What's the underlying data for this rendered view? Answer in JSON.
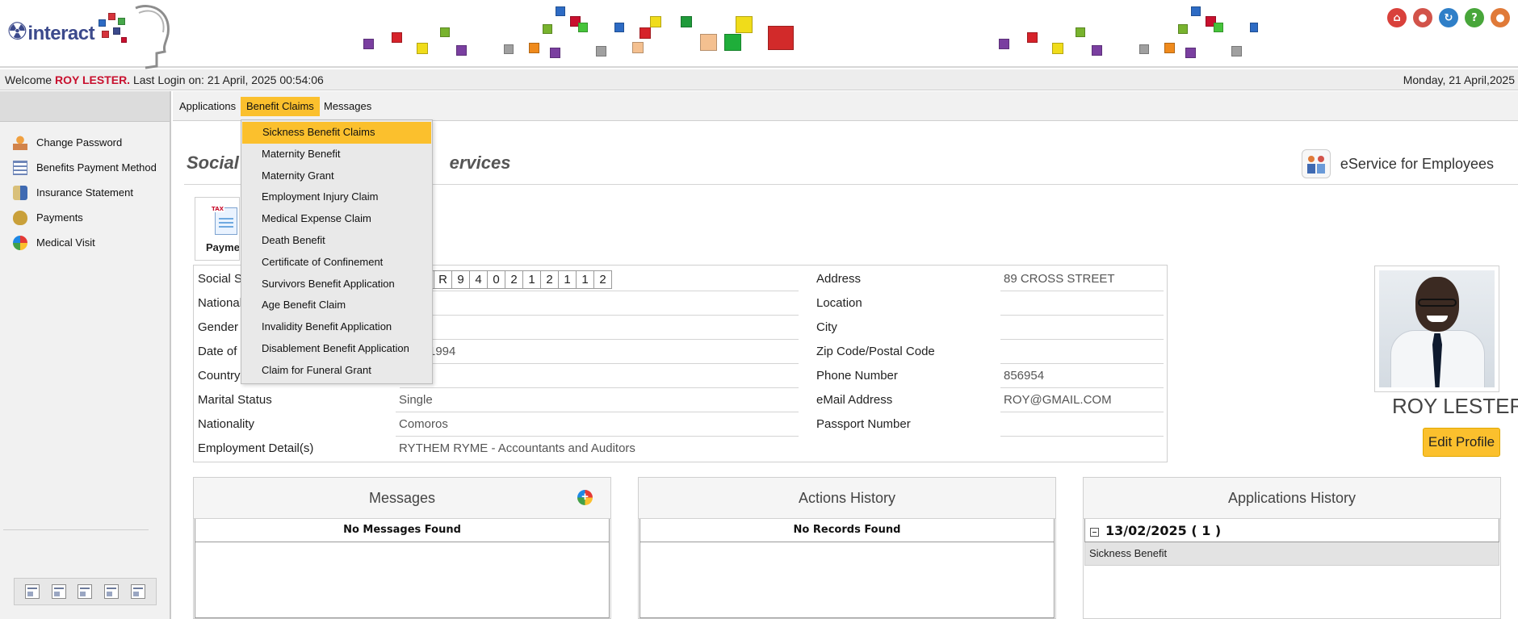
{
  "brand": {
    "logo_text": "interact"
  },
  "header_icons": [
    {
      "icon": "home-icon",
      "color": "#d9413b",
      "glyph": "⌂"
    },
    {
      "icon": "user-icon",
      "color": "#d2534a",
      "glyph": "●"
    },
    {
      "icon": "refresh-icon",
      "color": "#2f7fc8",
      "glyph": "↻"
    },
    {
      "icon": "help-icon",
      "color": "#48a63a",
      "glyph": "?"
    },
    {
      "icon": "logout-icon",
      "color": "#e07a38",
      "glyph": "●"
    }
  ],
  "welcome": {
    "prefix": "Welcome ",
    "user": "ROY LESTER.",
    "last_login": " Last Login on: 21 April, 2025 00:54:06",
    "date": "Monday, 21 April,2025"
  },
  "sidebar": {
    "items": [
      {
        "label": "Change Password",
        "icon": "key-user-icon"
      },
      {
        "label": "Benefits Payment Method",
        "icon": "form-icon"
      },
      {
        "label": "Insurance Statement",
        "icon": "shield-doc-icon"
      },
      {
        "label": "Payments",
        "icon": "money-bag-icon"
      },
      {
        "label": "Medical Visit",
        "icon": "globe-icon"
      }
    ]
  },
  "nav": {
    "tabs": [
      {
        "label": "Applications"
      },
      {
        "label": "Benefit Claims"
      },
      {
        "label": "Messages"
      }
    ]
  },
  "dropdown": {
    "items": [
      "Sickness Benefit Claims",
      "Maternity Benefit",
      "Maternity Grant",
      "Employment Injury Claim",
      "Medical Expense Claim",
      "Death Benefit",
      "Certificate of Confinement",
      "Survivors Benefit Application",
      "Age Benefit Claim",
      "Invalidity Benefit Application",
      "Disablement Benefit Application",
      "Claim for Funeral Grant"
    ]
  },
  "main": {
    "title_left": "Social S",
    "title_right": "ervices",
    "eservice": "eService for Employees",
    "pay_tile_label": "Payme"
  },
  "ssn_digits": [
    "S",
    "R",
    "9",
    "4",
    "0",
    "2",
    "1",
    "2",
    "1",
    "1",
    "2"
  ],
  "info_left": [
    {
      "label": "Social Se",
      "value": ""
    },
    {
      "label": "National",
      "value": ""
    },
    {
      "label": "Gender",
      "value": ""
    },
    {
      "label": "Date of B",
      "value": "1994"
    },
    {
      "label": "Country",
      "value": ""
    },
    {
      "label": "Marital Status",
      "value": "Single"
    },
    {
      "label": "Nationality",
      "value": "Comoros"
    },
    {
      "label": "Employment Detail(s)",
      "value": "RYTHEM RYME - Accountants and Auditors"
    }
  ],
  "info_right": [
    {
      "label": "Address",
      "value": "89 CROSS STREET"
    },
    {
      "label": "Location",
      "value": ""
    },
    {
      "label": "City",
      "value": ""
    },
    {
      "label": "Zip Code/Postal Code",
      "value": ""
    },
    {
      "label": "Phone Number",
      "value": "856954"
    },
    {
      "label": "eMail Address",
      "value": "ROY@GMAIL.COM"
    },
    {
      "label": "Passport Number",
      "value": ""
    }
  ],
  "profile": {
    "name": "ROY LESTER",
    "edit_label": "Edit Profile"
  },
  "panels": {
    "messages": {
      "title": "Messages",
      "empty": "No Messages Found"
    },
    "actions": {
      "title": "Actions History",
      "empty": "No Records Found"
    },
    "applications": {
      "title": "Applications History",
      "date_group": "13/02/2025 ( 1 )",
      "item": "Sickness Benefit"
    }
  },
  "colors": {
    "accent": "#fbc02d",
    "brand_red": "#c8102e",
    "brand_blue": "#3c4a8c"
  }
}
